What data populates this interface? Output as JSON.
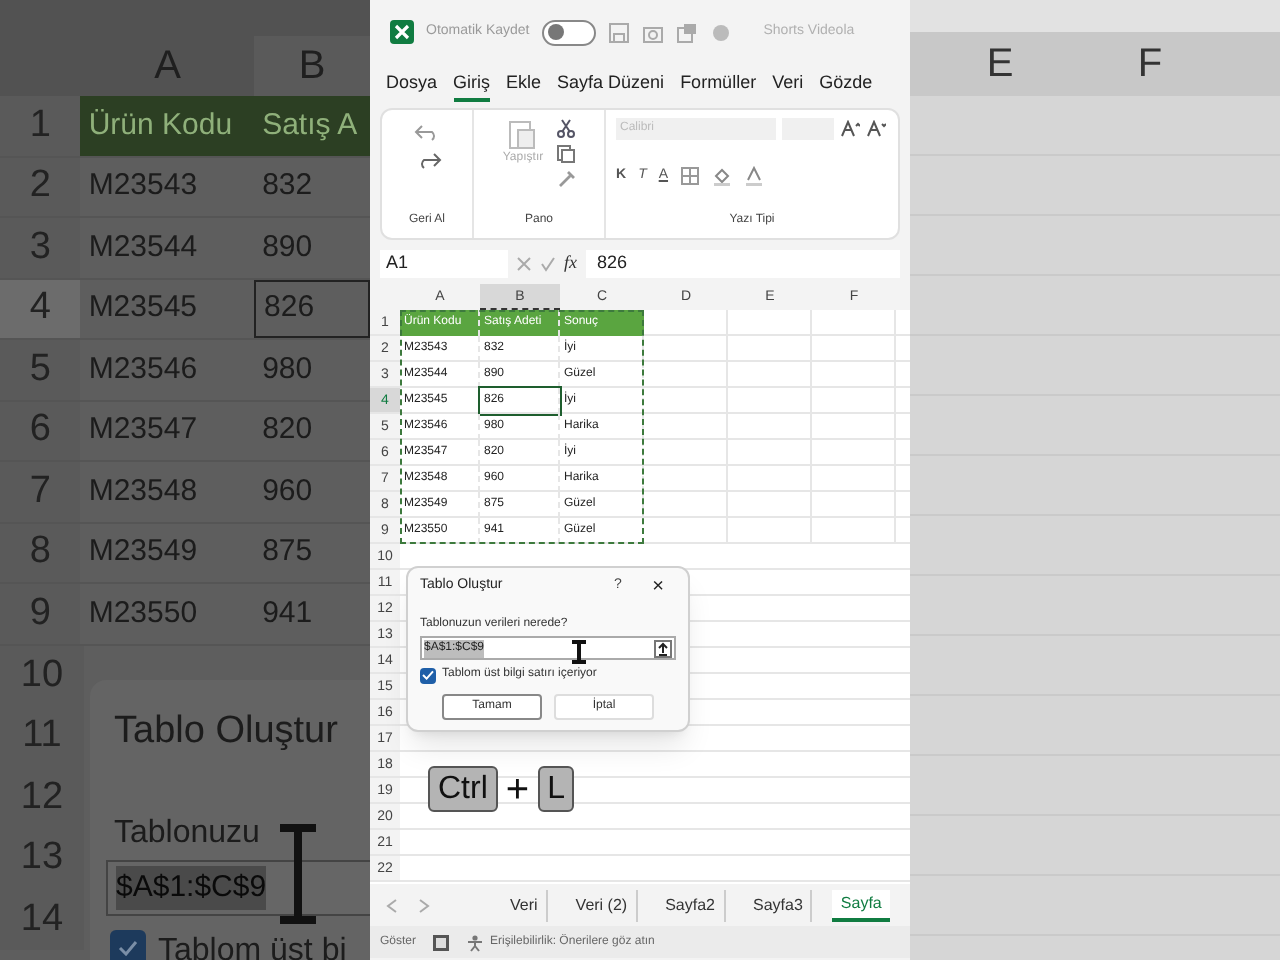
{
  "left_backdrop": {
    "columns": [
      "A",
      "B"
    ],
    "rows": [
      {
        "num": "1",
        "cells": [
          "Ürün Kodu",
          "Satış A"
        ],
        "header": true,
        "selected": false
      },
      {
        "num": "2",
        "cells": [
          "M23543",
          "832"
        ],
        "header": false,
        "selected": false
      },
      {
        "num": "3",
        "cells": [
          "M23544",
          "890"
        ],
        "header": false,
        "selected": false
      },
      {
        "num": "4",
        "cells": [
          "M23545",
          "826"
        ],
        "header": false,
        "selected": true
      },
      {
        "num": "5",
        "cells": [
          "M23546",
          "980"
        ],
        "header": false,
        "selected": false
      },
      {
        "num": "6",
        "cells": [
          "M23547",
          "820"
        ],
        "header": false,
        "selected": false
      },
      {
        "num": "7",
        "cells": [
          "M23548",
          "960"
        ],
        "header": false,
        "selected": false
      },
      {
        "num": "8",
        "cells": [
          "M23549",
          "875"
        ],
        "header": false,
        "selected": false
      },
      {
        "num": "9",
        "cells": [
          "M23550",
          "941"
        ],
        "header": false,
        "selected": false
      }
    ],
    "empty_rows": [
      "10",
      "11",
      "12",
      "13",
      "14"
    ],
    "dialog": {
      "title": "Tablo Oluştur",
      "label": "Tablonuzu",
      "value": "$A$1:$C$9",
      "checkbox_label": "Tablom üst bi",
      "checked": true
    }
  },
  "right_backdrop": {
    "columns": [
      "E",
      "F"
    ]
  },
  "title_bar": {
    "autosave_label": "Otomatik Kaydet",
    "autosave_on": false,
    "file_name": "Shorts Videola"
  },
  "menu_tabs": [
    {
      "label": "Dosya",
      "selected": false
    },
    {
      "label": "Giriş",
      "selected": true
    },
    {
      "label": "Ekle",
      "selected": false
    },
    {
      "label": "Sayfa Düzeni",
      "selected": false
    },
    {
      "label": "Formüller",
      "selected": false
    },
    {
      "label": "Veri",
      "selected": false
    },
    {
      "label": "Gözde",
      "selected": false
    }
  ],
  "ribbon": {
    "undo_group": "Geri Al",
    "clipboard_group": "Pano",
    "paste_label": "Yapıştır",
    "font_group": "Yazı Tipi",
    "font_name": "Calibri",
    "format_buttons": [
      "K",
      "T",
      "A"
    ]
  },
  "formula_bar": {
    "name_box": "A1",
    "fx": "fx",
    "value": "826"
  },
  "sheet": {
    "columns": [
      "A",
      "B",
      "C",
      "D",
      "E",
      "F"
    ],
    "rows": [
      {
        "num": "1",
        "cells": [
          "Ürün Kodu",
          "Satış Adeti",
          "Sonuç"
        ],
        "header": true,
        "selected": false
      },
      {
        "num": "2",
        "cells": [
          "M23543",
          "832",
          "İyi"
        ],
        "header": false,
        "selected": false
      },
      {
        "num": "3",
        "cells": [
          "M23544",
          "890",
          "Güzel"
        ],
        "header": false,
        "selected": false
      },
      {
        "num": "4",
        "cells": [
          "M23545",
          "826",
          "İyi"
        ],
        "header": false,
        "selected": true
      },
      {
        "num": "5",
        "cells": [
          "M23546",
          "980",
          "Harika"
        ],
        "header": false,
        "selected": false
      },
      {
        "num": "6",
        "cells": [
          "M23547",
          "820",
          "İyi"
        ],
        "header": false,
        "selected": false
      },
      {
        "num": "7",
        "cells": [
          "M23548",
          "960",
          "Harika"
        ],
        "header": false,
        "selected": false
      },
      {
        "num": "8",
        "cells": [
          "M23549",
          "875",
          "Güzel"
        ],
        "header": false,
        "selected": false
      },
      {
        "num": "9",
        "cells": [
          "M23550",
          "941",
          "Güzel"
        ],
        "header": false,
        "selected": false
      }
    ],
    "empty_rows": [
      "10",
      "11",
      "12",
      "13",
      "14",
      "15",
      "16",
      "17",
      "18",
      "19",
      "20",
      "21",
      "22"
    ]
  },
  "dialog": {
    "title": "Tablo Oluştur",
    "help": "?",
    "close": "×",
    "label": "Tablonuzun verileri nerede?",
    "value": "$A$1:$C$9",
    "checkbox_label": "Tablom üst bilgi satırı içeriyor",
    "checked": true,
    "buttons": [
      {
        "label": "Tamam",
        "default": true
      },
      {
        "label": "İptal",
        "default": false
      }
    ]
  },
  "shortcut": {
    "keys": [
      "Ctrl",
      "L"
    ],
    "joiner": "+"
  },
  "sheet_tabs": [
    {
      "label": "Veri",
      "selected": false
    },
    {
      "label": "Veri (2)",
      "selected": false
    },
    {
      "label": "Sayfa2",
      "selected": false
    },
    {
      "label": "Sayfa3",
      "selected": false
    },
    {
      "label": "Sayfa",
      "selected": true
    }
  ],
  "status_bar": {
    "show_label": "Göster",
    "accessibility": "Erişilebilirlik: Önerilere göz atın"
  }
}
